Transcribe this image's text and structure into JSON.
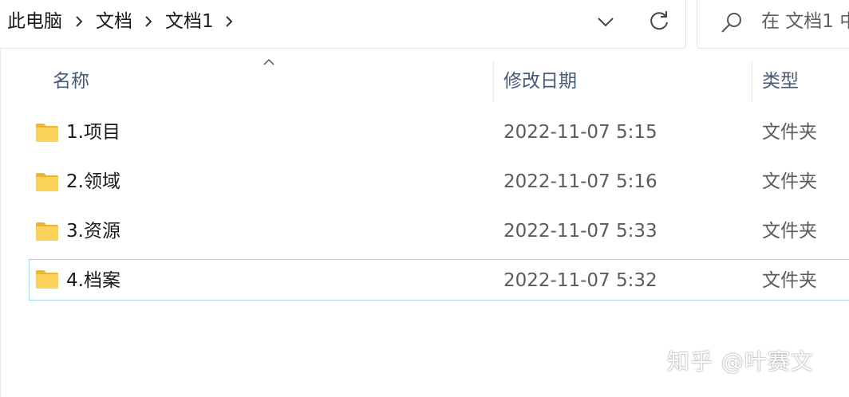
{
  "breadcrumb": {
    "items": [
      "此电脑",
      "文档",
      "文档1"
    ]
  },
  "search": {
    "placeholder": "在 文档1 中"
  },
  "columns": {
    "name": "名称",
    "date_modified": "修改日期",
    "type": "类型",
    "sorted_by": "名称",
    "sort_direction": "ascending"
  },
  "files": [
    {
      "name": "1.项目",
      "date": "2022-11-07 5:15",
      "type": "文件夹",
      "icon": "folder-icon",
      "selected": false
    },
    {
      "name": "2.领域",
      "date": "2022-11-07 5:16",
      "type": "文件夹",
      "icon": "folder-icon",
      "selected": false
    },
    {
      "name": "3.资源",
      "date": "2022-11-07 5:33",
      "type": "文件夹",
      "icon": "folder-icon",
      "selected": false
    },
    {
      "name": "4.档案",
      "date": "2022-11-07 5:32",
      "type": "文件夹",
      "icon": "folder-icon",
      "selected": true
    }
  ],
  "watermark": {
    "text": "知乎 @叶赛文"
  },
  "colors": {
    "selection_border": "#9fd8ee",
    "header_text": "#465a78",
    "folder_yellow": "#f8c846"
  }
}
